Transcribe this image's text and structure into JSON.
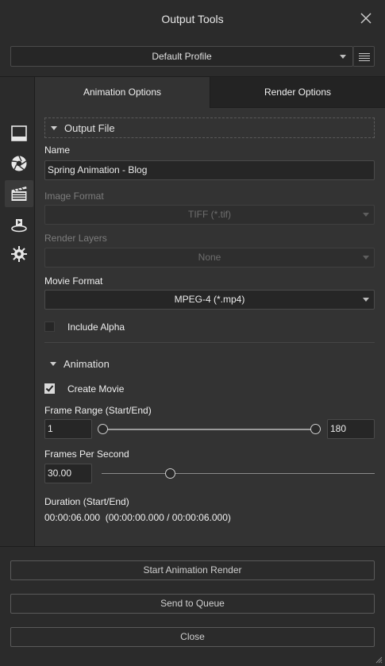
{
  "window": {
    "title": "Output Tools"
  },
  "profile": {
    "selected": "Default Profile"
  },
  "tabs": [
    {
      "label": "Animation Options",
      "active": true
    },
    {
      "label": "Render Options",
      "active": false
    }
  ],
  "sidebar": {
    "items": [
      {
        "icon": "viewport-icon"
      },
      {
        "icon": "aperture-icon"
      },
      {
        "icon": "clapperboard-icon",
        "active": true
      },
      {
        "icon": "turntable-icon"
      },
      {
        "icon": "sun-gear-icon"
      }
    ]
  },
  "output_file": {
    "section_title": "Output File",
    "name_label": "Name",
    "name_value": "Spring Animation - Blog",
    "image_format_label": "Image Format",
    "image_format_value": "TIFF (*.tif)",
    "render_layers_label": "Render Layers",
    "render_layers_value": "None",
    "movie_format_label": "Movie Format",
    "movie_format_value": "MPEG-4 (*.mp4)",
    "include_alpha_label": "Include Alpha",
    "include_alpha_checked": false
  },
  "animation": {
    "section_title": "Animation",
    "create_movie_label": "Create Movie",
    "create_movie_checked": true,
    "frame_range_label": "Frame Range (Start/End)",
    "frame_start": "1",
    "frame_end": "180",
    "fps_label": "Frames Per Second",
    "fps_value": "30.00",
    "fps_slider_fraction": 0.25,
    "duration_label": "Duration (Start/End)",
    "duration_value": "00:00:06.000  (00:00:00.000 / 00:00:06.000)"
  },
  "actions": {
    "start_render": "Start Animation Render",
    "send_queue": "Send to Queue",
    "close": "Close"
  },
  "colors": {
    "background": "#2b2b2b",
    "panel": "#333333",
    "field": "#262626",
    "text": "#e6e6e6"
  }
}
